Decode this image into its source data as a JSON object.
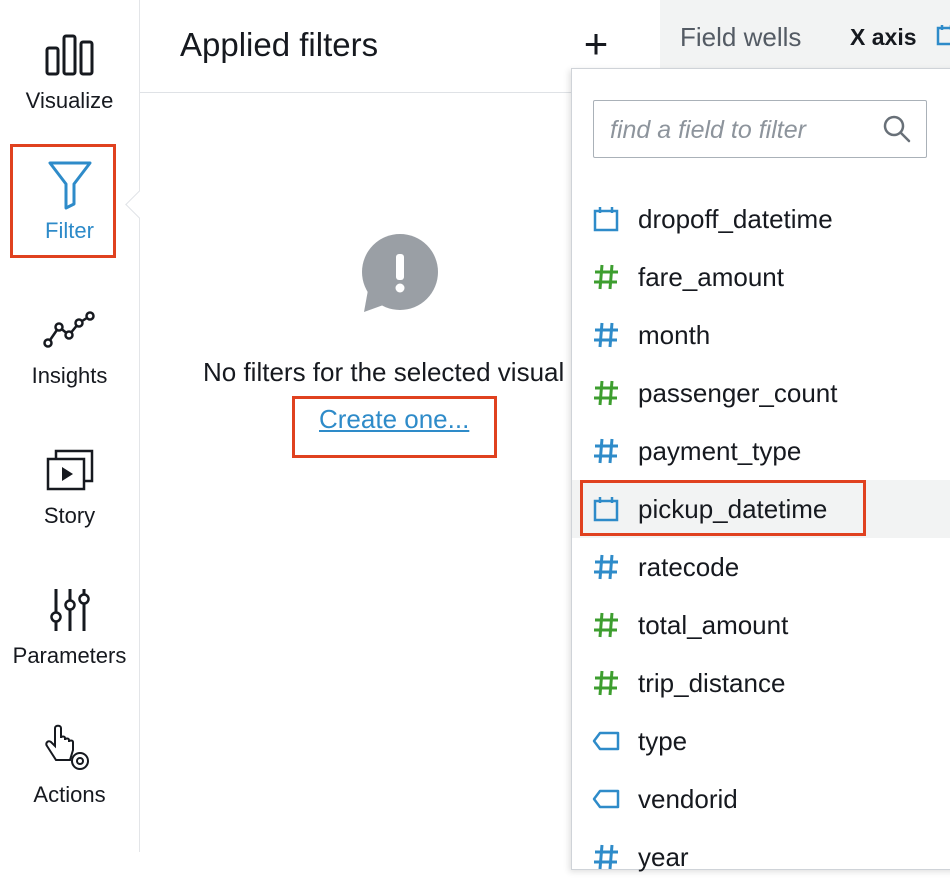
{
  "sidebar": {
    "items": [
      {
        "label": "Visualize",
        "icon": "bar-chart-icon",
        "active": false
      },
      {
        "label": "Filter",
        "icon": "filter-funnel-icon",
        "active": true
      },
      {
        "label": "Insights",
        "icon": "insights-line-icon",
        "active": false
      },
      {
        "label": "Story",
        "icon": "story-play-icon",
        "active": false
      },
      {
        "label": "Parameters",
        "icon": "sliders-icon",
        "active": false
      },
      {
        "label": "Actions",
        "icon": "pointer-gear-icon",
        "active": false
      }
    ]
  },
  "filter_panel": {
    "title": "Applied filters",
    "add_label": "+",
    "empty_message": "No filters for the selected visual",
    "create_link": "Create one..."
  },
  "field_wells": {
    "title": "Field wells",
    "x_axis_label": "X axis"
  },
  "field_picker": {
    "search_placeholder": "find a field to filter",
    "search_value": "",
    "fields": [
      {
        "name": "dropoff_datetime",
        "type": "date",
        "color": "#2e8bc9"
      },
      {
        "name": "fare_amount",
        "type": "measure",
        "color": "#3d9e2f"
      },
      {
        "name": "month",
        "type": "dimension-number",
        "color": "#2e8bc9"
      },
      {
        "name": "passenger_count",
        "type": "measure",
        "color": "#3d9e2f"
      },
      {
        "name": "payment_type",
        "type": "dimension-number",
        "color": "#2e8bc9"
      },
      {
        "name": "pickup_datetime",
        "type": "date",
        "color": "#2e8bc9",
        "hovered": true
      },
      {
        "name": "ratecode",
        "type": "dimension-number",
        "color": "#2e8bc9"
      },
      {
        "name": "total_amount",
        "type": "measure",
        "color": "#3d9e2f"
      },
      {
        "name": "trip_distance",
        "type": "measure",
        "color": "#3d9e2f"
      },
      {
        "name": "type",
        "type": "string",
        "color": "#2e8bc9"
      },
      {
        "name": "vendorid",
        "type": "string",
        "color": "#2e8bc9"
      },
      {
        "name": "year",
        "type": "dimension-number",
        "color": "#2e8bc9"
      }
    ]
  },
  "colors": {
    "accent": "#2e8bc9",
    "highlight": "#e0411f",
    "measure": "#3d9e2f"
  }
}
